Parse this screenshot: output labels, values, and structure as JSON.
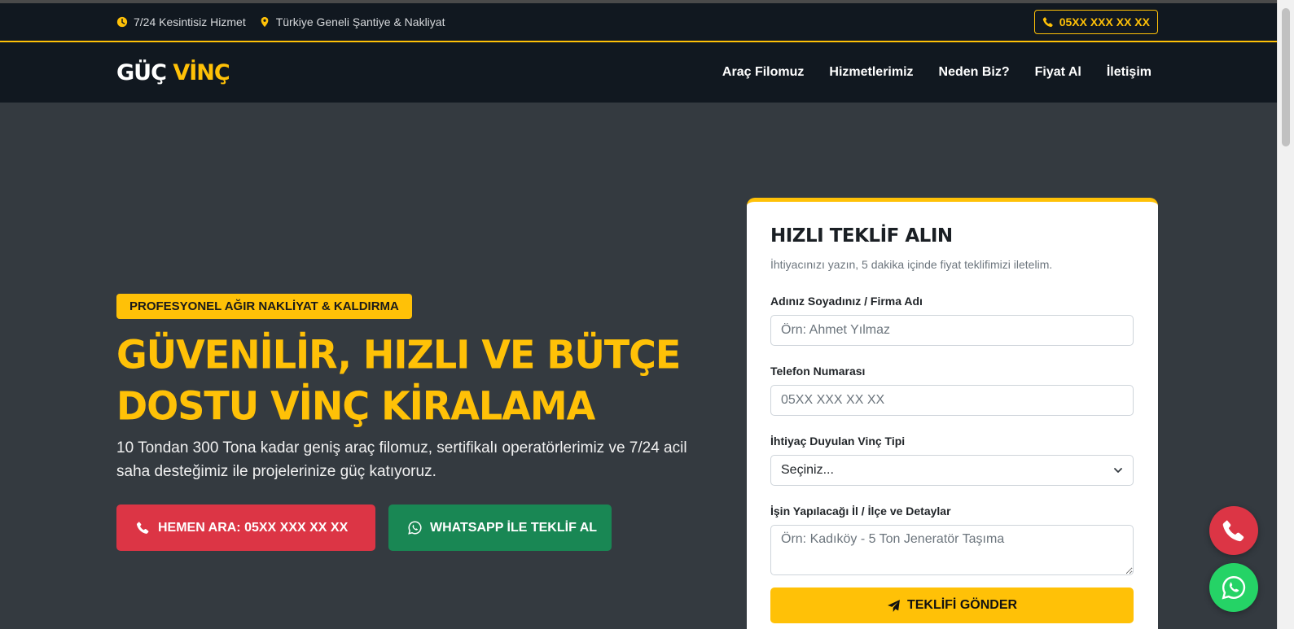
{
  "topbar": {
    "hours": "7/24 Kesintisiz Hizmet",
    "location": "Türkiye Geneli Şantiye & Nakliyat",
    "phone": "05XX XXX XX XX"
  },
  "brand": {
    "part1": "GÜÇ",
    "part2": "VİNÇ"
  },
  "nav": [
    "Araç Filomuz",
    "Hizmetlerimiz",
    "Neden Biz?",
    "Fiyat Al",
    "İletişim"
  ],
  "hero": {
    "badge": "PROFESYONEL AĞIR NAKLİYAT & KALDIRMA",
    "title_line1": "GÜVENİLİR, HIZLI VE BÜTÇE",
    "title_line2": "DOSTU VİNÇ KİRALAMA",
    "text": "10 Tondan 300 Tona kadar geniş araç filomuz, sertifikalı operatörlerimiz ve 7/24 acil saha desteğimiz ile projelerinize güç katıyoruz.",
    "call_button": "HEMEN ARA: 05XX XXX XX XX",
    "whatsapp_button": "WHATSAPP İLE TEKLİF AL"
  },
  "form": {
    "title": "HIZLI TEKLİF ALIN",
    "subtitle": "İhtiyacınızı yazın, 5 dakika içinde fiyat teklifimizi iletelim.",
    "name_label": "Adınız Soyadınız / Firma Adı",
    "name_placeholder": "Örn: Ahmet Yılmaz",
    "phone_label": "Telefon Numarası",
    "phone_placeholder": "05XX XXX XX XX",
    "crane_label": "İhtiyaç Duyulan Vinç Tipi",
    "crane_selected": "Seçiniz...",
    "details_label": "İşin Yapılacağı İl / İlçe ve Detaylar",
    "details_placeholder": "Örn: Kadıköy - 5 Ton Jeneratör Taşıma",
    "submit": "TEKLİFİ GÖNDER"
  },
  "colors": {
    "accent": "#ffc107",
    "dark": "#111820",
    "hero_bg": "#343a40",
    "red": "#dc3545",
    "green": "#198754",
    "whatsapp": "#25d366"
  }
}
